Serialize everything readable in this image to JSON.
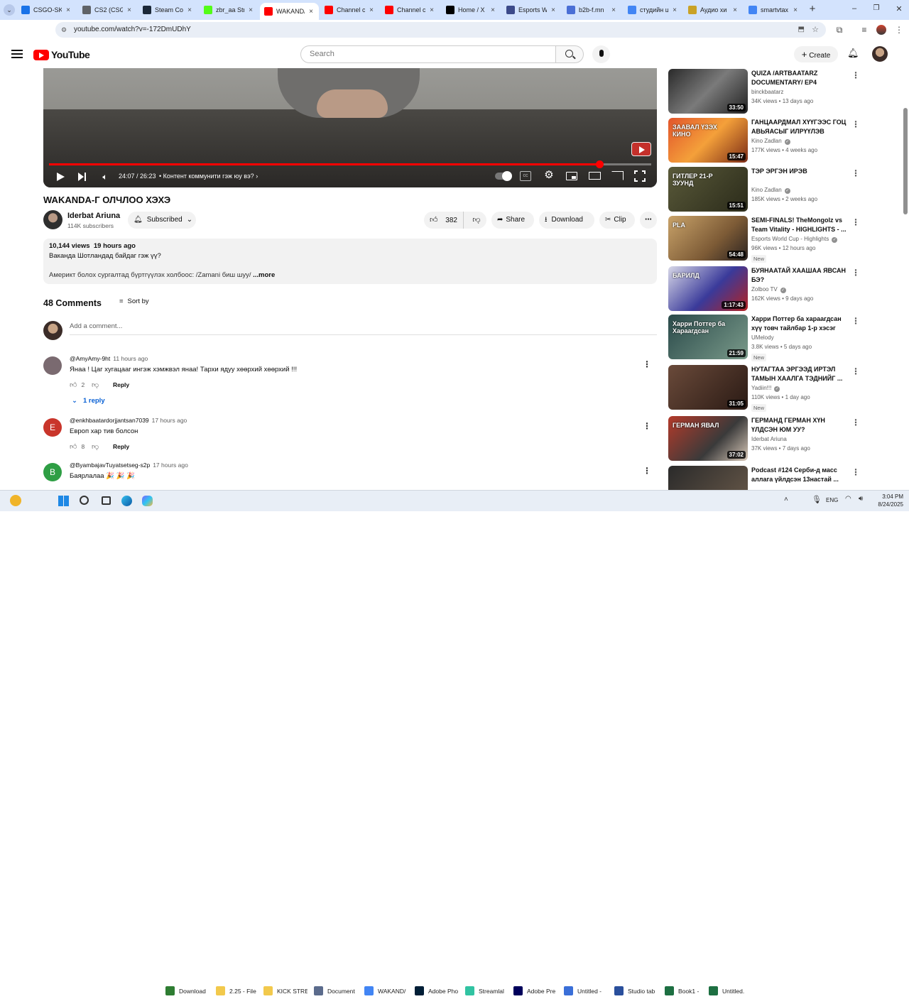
{
  "browser": {
    "tabs": [
      {
        "label": "CSGO-SKI",
        "icon": "globe-icon",
        "color": "#1a73e8"
      },
      {
        "label": "CS2 (CSGO",
        "icon": "document-icon",
        "color": "#5f6368"
      },
      {
        "label": "Steam Co",
        "icon": "steam-icon",
        "color": "#1b2838"
      },
      {
        "label": "zbr_aa Str",
        "icon": "kick-icon",
        "color": "#53fc18"
      },
      {
        "label": "WAKAND/",
        "icon": "youtube-icon",
        "color": "#ff0000"
      },
      {
        "label": "Channel c",
        "icon": "youtube-icon",
        "color": "#ff0000"
      },
      {
        "label": "Channel c",
        "icon": "youtube-icon",
        "color": "#ff0000"
      },
      {
        "label": "Home / X",
        "icon": "x-icon",
        "color": "#000000"
      },
      {
        "label": "Esports W",
        "icon": "esports-icon",
        "color": "#3c4a8a"
      },
      {
        "label": "b2b-f.mn",
        "icon": "globe-icon",
        "color": "#4a6fd6"
      },
      {
        "label": "студийн ц",
        "icon": "google-icon",
        "color": "#4285f4"
      },
      {
        "label": "Аудио хи",
        "icon": "audio-icon",
        "color": "#c9a227"
      },
      {
        "label": "smartvtax",
        "icon": "google-icon",
        "color": "#4285f4"
      }
    ],
    "url": "youtube.com/watch?v=-172DmUDhY"
  },
  "youtube": {
    "logo_text": "YouTube",
    "search_placeholder": "Search",
    "create_label": "Create",
    "player": {
      "time": "24:07 / 26:23",
      "chapter": "• Контент коммунити гэж юу вэ?",
      "progress": 0.914
    },
    "video_title": "WAKANDA-Г ОЛЧЛОО ХЭХЭ",
    "channel": {
      "name": "Iderbat Ariuna",
      "subscribers": "114K subscribers",
      "subscribed_label": "Subscribed"
    },
    "actions": {
      "likes": "382",
      "share": "Share",
      "download": "Download",
      "clip": "Clip"
    },
    "description": {
      "views": "10,144 views",
      "age": "19 hours ago",
      "line1": "Ваканда Шотландад байдаг гэж үү?",
      "line2": "Америкт болох сургалтад бүртгүүлэх холбоос: /Zamani биш шуу/",
      "more": "...more"
    },
    "comments": {
      "count_label": "48 Comments",
      "sort_label": "Sort by",
      "add_placeholder": "Add a comment...",
      "items": [
        {
          "author": "@AmyAmy-9ht",
          "time": "11 hours ago",
          "text": "Янаа ! Цаг хугацааг ингэж хэмжвэл  янаа! Тархи ядуу хөөрхий хөөрхий !!!",
          "likes": "2",
          "reply": "Reply",
          "replies": "1 reply",
          "avatar_letter": "",
          "avatar_color": "#7a6a70"
        },
        {
          "author": "@enkhbaatardorjjantsan7039",
          "time": "17 hours ago",
          "text": "Европ хар тив болсон",
          "likes": "8",
          "reply": "Reply",
          "avatar_letter": "E",
          "avatar_color": "#c9352b"
        },
        {
          "author": "@ByambajavTuyatsetseg-s2p",
          "time": "17 hours ago",
          "text": "Баярлалаа 🎉 🎉 🎉",
          "avatar_letter": "B",
          "avatar_color": "#2e9e44"
        }
      ]
    },
    "recommendations": [
      {
        "title": "QUIZA /ARTBAATARZ DOCUMENTARY/ EP4",
        "channel": "binckbaatarz",
        "meta": "34K views • 13 days ago",
        "duration": "33:50",
        "verified": false,
        "new": false
      },
      {
        "title": "ГАНЦААРДМАЛ ХҮҮГЭЭС ГОЦ АВЬЯАСЫГ ИЛРҮҮЛЭВ",
        "channel": "Kino Zadlan",
        "meta": "177K views • 4 weeks ago",
        "duration": "15:47",
        "verified": true,
        "new": false,
        "thumb_text": "ЗААВАЛ ҮЗЭХ КИНО"
      },
      {
        "title": "ТЭР ЭРГЭН ИРЭВ",
        "channel": "Kino Zadlan",
        "meta": "185K views • 2 weeks ago",
        "duration": "15:51",
        "verified": true,
        "new": false,
        "thumb_text": "ГИТЛЕР 21-Р ЗУУНД"
      },
      {
        "title": "SEMI-FINALS! TheMongolz vs Team Vitality - HIGHLIGHTS - ...",
        "channel": "Esports World Cup - Highlights",
        "meta": "96K views • 12 hours ago",
        "duration": "54:48",
        "verified": true,
        "new": true,
        "thumb_text": "PLA"
      },
      {
        "title": "БУЯНААТАЙ ХААШАА ЯВСАН БЭ?",
        "channel": "Zolboo TV",
        "meta": "162K views • 9 days ago",
        "duration": "1:17:43",
        "verified": true,
        "new": false,
        "thumb_text": "БАРИЛД"
      },
      {
        "title": "Харри Поттер ба хараагдсан хүү товч тайлбар 1-р хэсэг",
        "channel": "UMelody",
        "meta": "3.8K views • 5 days ago",
        "duration": "21:59",
        "verified": false,
        "new": true,
        "thumb_text": "Харри Поттер ба Хараагдсан"
      },
      {
        "title": "НУТАГТАА ЭРГЭЭД ИРТЭЛ ТАМЫН ХААЛГА ТЭДНИЙГ ...",
        "channel": "Yadiin!!!",
        "meta": "110K views • 1 day ago",
        "duration": "31:05",
        "verified": true,
        "new": true
      },
      {
        "title": "ГЕРМАНД ГЕРМАН ХҮН ҮЛДСЭН ЮМ УУ?",
        "channel": "Iderbat Ariuna",
        "meta": "37K views • 7 days ago",
        "duration": "37:02",
        "verified": false,
        "new": false,
        "thumb_text": "ГЕРМАН ЯВАЛ"
      },
      {
        "title": "Podcast #124 Серби-д масс аллага үйлдсэн 13настай ...",
        "channel": "",
        "meta": "",
        "duration": "",
        "verified": false,
        "new": false
      }
    ]
  },
  "taskbar": {
    "apps": [
      {
        "label": "Download",
        "icon": "download-icon",
        "color": "#2e7d32"
      },
      {
        "label": "2.25 - File",
        "icon": "folder-icon",
        "color": "#f2c94c"
      },
      {
        "label": "KICK STRE",
        "icon": "folder-icon",
        "color": "#f2c94c"
      },
      {
        "label": "Document",
        "icon": "document-icon",
        "color": "#5b6b8c"
      },
      {
        "label": "WAKAND/",
        "icon": "chrome-icon",
        "color": "#4285f4"
      },
      {
        "label": "Adobe Pho",
        "icon": "photoshop-icon",
        "color": "#001e36"
      },
      {
        "label": "Adobe Pre",
        "icon": "premiere-icon",
        "color": "#00005b"
      },
      {
        "label": "Streamlal",
        "icon": "streamlabs-icon",
        "color": "#31c3a2"
      },
      {
        "label": "Untitled -",
        "icon": "app-icon",
        "color": "#3a6fd8"
      },
      {
        "label": "Studio tab",
        "icon": "app-icon",
        "color": "#2a4f9c"
      },
      {
        "label": "Book1 -",
        "icon": "excel-icon",
        "color": "#1d6f42"
      },
      {
        "label": "Untitled.",
        "icon": "excel-icon",
        "color": "#1d6f42"
      }
    ],
    "lang": "ENG",
    "time": "3:04 PM",
    "date": "8/24/2025"
  }
}
